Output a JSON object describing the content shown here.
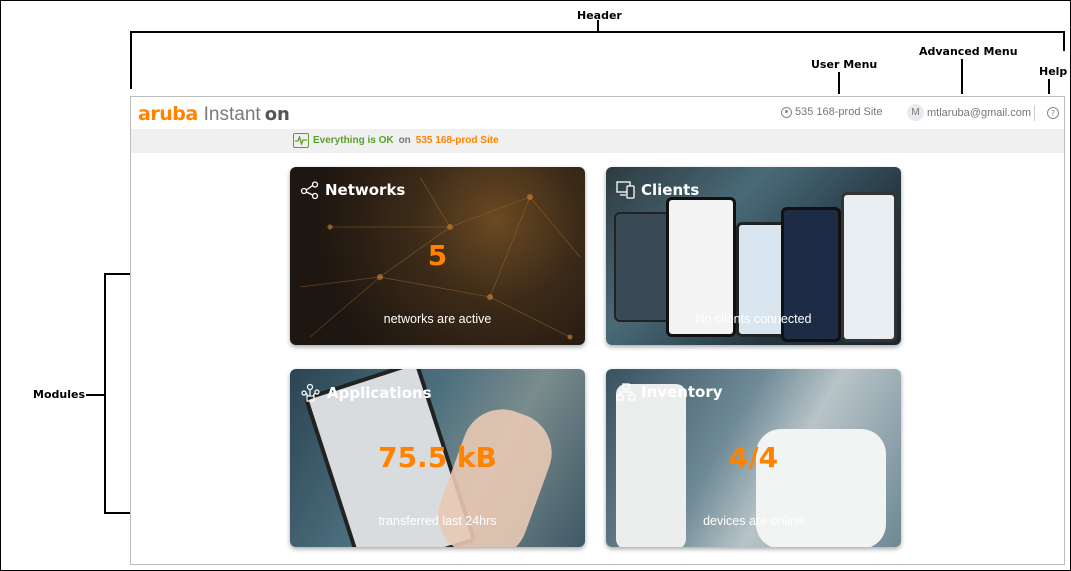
{
  "annotations": {
    "header": "Header",
    "user_menu": "User Menu",
    "advanced_menu": "Advanced Menu",
    "help": "Help",
    "modules": "Modules"
  },
  "app": {
    "logo_brand": "aruba",
    "logo_product": "Instant",
    "logo_on": "on",
    "site_menu_label": "535 168-prod Site",
    "user_avatar_initial": "M",
    "user_email": "mtlaruba@gmail.com",
    "help_symbol": "?",
    "status_ok": "Everything is OK",
    "status_on": "on",
    "status_site": "535 168-prod Site"
  },
  "modules": {
    "networks": {
      "title": "Networks",
      "value": "5",
      "subtitle": "networks are active",
      "icon": "network-icon"
    },
    "clients": {
      "title": "Clients",
      "value": "",
      "subtitle": "No clients connected",
      "icon": "devices-icon"
    },
    "applications": {
      "title": "Applications",
      "value": "75.5 kB",
      "subtitle": "transferred last 24hrs",
      "icon": "applications-icon"
    },
    "inventory": {
      "title": "Inventory",
      "value": "4/4",
      "subtitle": "devices are online",
      "icon": "inventory-icon"
    }
  },
  "colors": {
    "accent": "#ff8300",
    "ok_green": "#5aa02c"
  }
}
